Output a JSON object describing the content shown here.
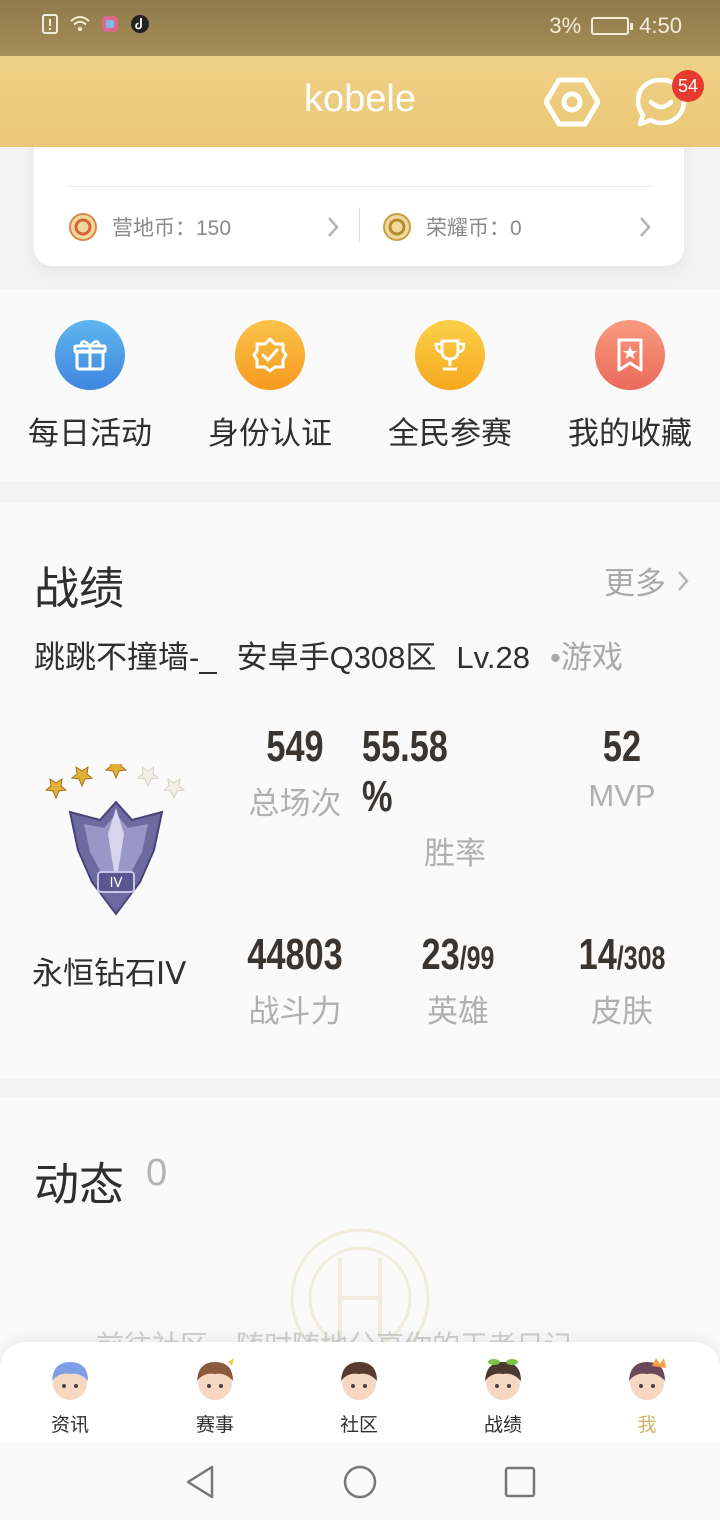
{
  "status_bar": {
    "battery_percent": "3%",
    "time": "4:50"
  },
  "header": {
    "title": "kobele",
    "message_badge": "54"
  },
  "coins": {
    "camp": {
      "label": "营地币：",
      "value": "150"
    },
    "honor": {
      "label": "荣耀币：",
      "value": "0"
    }
  },
  "actions": [
    {
      "label": "每日活动",
      "icon": "gift-icon",
      "color": "#4a90e2"
    },
    {
      "label": "身份认证",
      "icon": "verified-badge-icon",
      "color": "#f5a623"
    },
    {
      "label": "全民参赛",
      "icon": "trophy-icon",
      "color": "#f6b829"
    },
    {
      "label": "我的收藏",
      "icon": "bookmark-star-icon",
      "color": "#f07a63"
    }
  ],
  "record": {
    "title": "战绩",
    "more": "更多",
    "player_name": "跳跳不撞墙-_",
    "server": "安卓手Q308区",
    "level": "Lv.28",
    "game_tag": "•游戏",
    "rank_name": "永恒钻石IV",
    "stats": {
      "total_games": {
        "value": "549",
        "label": "总场次"
      },
      "win_rate": {
        "value": "55.58",
        "unit": "%",
        "label": "胜率"
      },
      "mvp": {
        "value": "52",
        "label": "MVP"
      },
      "power": {
        "value": "44803",
        "label": "战斗力"
      },
      "heroes": {
        "value": "23",
        "total": "/99",
        "label": "英雄"
      },
      "skins": {
        "value": "14",
        "total": "/308",
        "label": "皮肤"
      }
    }
  },
  "dynamics": {
    "title": "动态",
    "count": "0",
    "hint": "前往社区，随时随地分享你的王者日记"
  },
  "tabs": [
    {
      "label": "资讯"
    },
    {
      "label": "赛事"
    },
    {
      "label": "社区"
    },
    {
      "label": "战绩"
    },
    {
      "label": "我"
    }
  ],
  "colors": {
    "header_gold": "#eac776",
    "active_tab": "#d4b26b",
    "badge_red": "#e83a2f"
  }
}
